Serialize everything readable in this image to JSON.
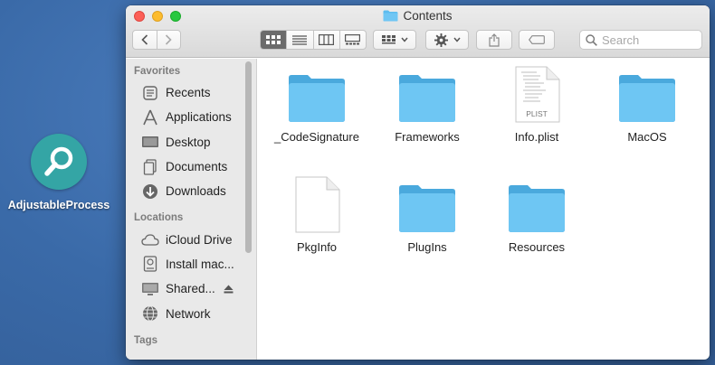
{
  "desktop": {
    "app_label": "AdjustableProcess"
  },
  "window": {
    "title": "Contents",
    "search_placeholder": "Search"
  },
  "sidebar": {
    "favorites_header": "Favorites",
    "favorites": [
      {
        "label": "Recents",
        "icon": "clock-icon"
      },
      {
        "label": "Applications",
        "icon": "applications-icon"
      },
      {
        "label": "Desktop",
        "icon": "desktop-icon"
      },
      {
        "label": "Documents",
        "icon": "document-icon"
      },
      {
        "label": "Downloads",
        "icon": "download-icon"
      }
    ],
    "locations_header": "Locations",
    "locations": [
      {
        "label": "iCloud Drive",
        "icon": "cloud-icon"
      },
      {
        "label": "Install mac...",
        "icon": "disk-icon"
      },
      {
        "label": "Shared...",
        "icon": "display-icon"
      },
      {
        "label": "Network",
        "icon": "globe-icon"
      }
    ],
    "tags_header": "Tags"
  },
  "files": [
    {
      "name": "_CodeSignature",
      "type": "folder"
    },
    {
      "name": "Frameworks",
      "type": "folder"
    },
    {
      "name": "Info.plist",
      "type": "plist",
      "badge": "PLIST"
    },
    {
      "name": "MacOS",
      "type": "folder"
    },
    {
      "name": "PkgInfo",
      "type": "document"
    },
    {
      "name": "PlugIns",
      "type": "folder"
    },
    {
      "name": "Resources",
      "type": "folder"
    }
  ],
  "colors": {
    "folder": "#5cbcef",
    "folder_tab": "#4aa9dd",
    "accent": "#34a5a5"
  }
}
